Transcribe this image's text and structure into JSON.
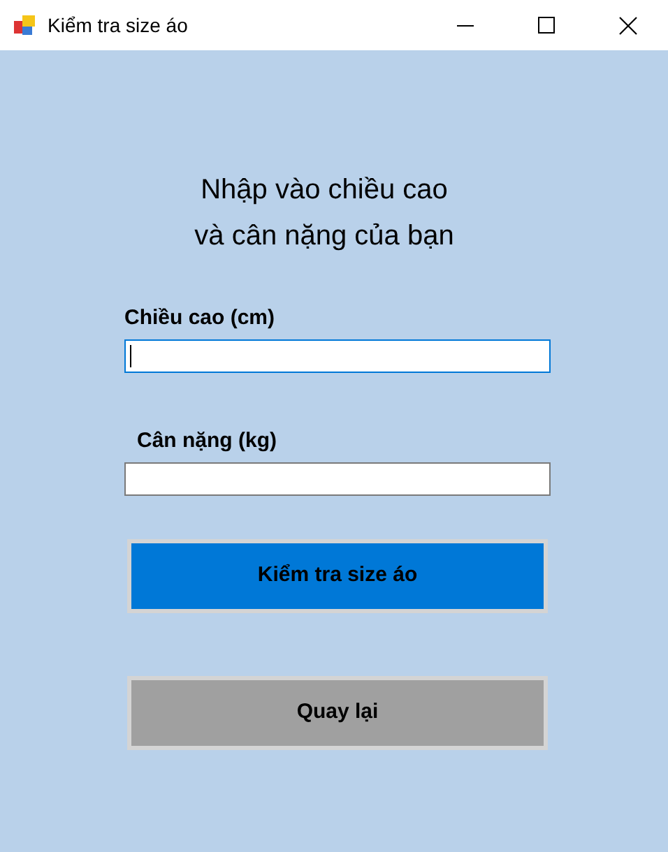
{
  "window": {
    "title": "Kiểm tra size áo"
  },
  "heading": "Nhập vào chiều cao\nvà cân nặng của bạn",
  "fields": [
    {
      "label": "Chiều cao (cm)",
      "focused": true
    },
    {
      "label": "Cân nặng (kg)",
      "focused": false
    }
  ],
  "buttons": [
    {
      "label": "Kiểm tra size áo",
      "kind": "primary"
    },
    {
      "label": "Quay lại",
      "kind": "secondary"
    }
  ]
}
